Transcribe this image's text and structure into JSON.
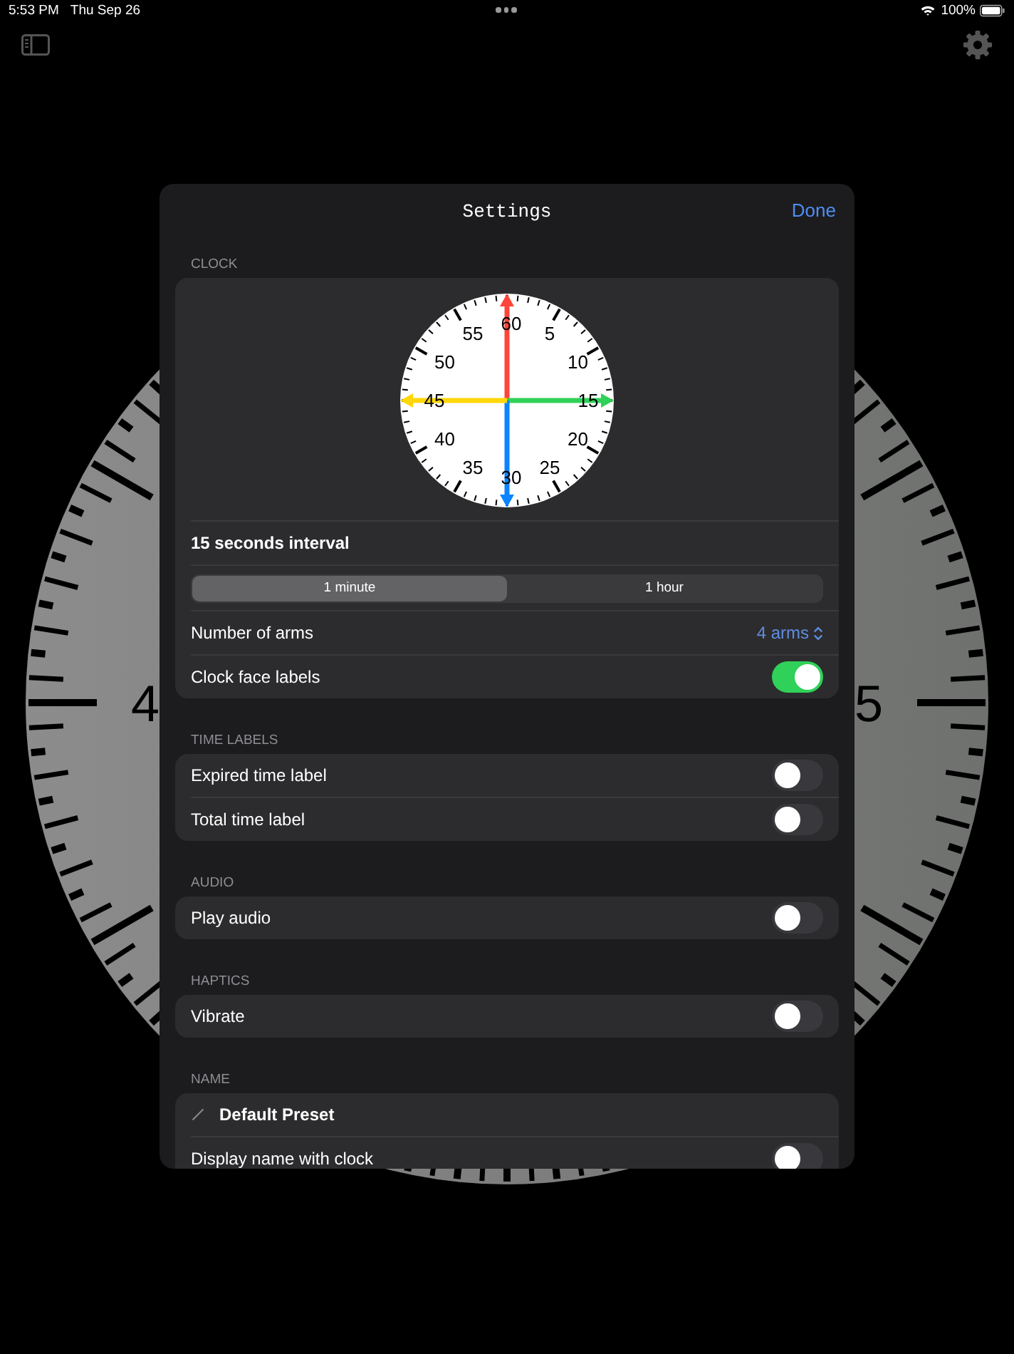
{
  "status_bar": {
    "time": "5:53 PM",
    "date": "Thu Sep 26",
    "battery": "100%"
  },
  "background_clock": {
    "labels": [
      "4",
      "5"
    ]
  },
  "settings": {
    "title": "Settings",
    "done": "Done",
    "sections": [
      {
        "header": "CLOCK",
        "rows": [
          {
            "kind": "preview",
            "labels": [
              "60",
              "5",
              "10",
              "15",
              "20",
              "25",
              "30",
              "35",
              "40",
              "45",
              "50",
              "55"
            ],
            "arms": [
              {
                "color": "#ff453a"
              },
              {
                "color": "#30d158"
              },
              {
                "color": "#0a84ff"
              },
              {
                "color": "#ffd60a"
              }
            ]
          },
          {
            "kind": "title",
            "label": "15 seconds interval"
          },
          {
            "kind": "segmented",
            "options": [
              {
                "label": "1 minute",
                "selected": true
              },
              {
                "label": "1 hour",
                "selected": false
              }
            ]
          },
          {
            "kind": "picker",
            "label": "Number of arms",
            "value": "4 arms"
          },
          {
            "kind": "toggle",
            "label": "Clock face labels",
            "on": true
          }
        ]
      },
      {
        "header": "TIME LABELS",
        "rows": [
          {
            "kind": "toggle",
            "label": "Expired time label",
            "on": false
          },
          {
            "kind": "toggle",
            "label": "Total time label",
            "on": false
          }
        ]
      },
      {
        "header": "AUDIO",
        "rows": [
          {
            "kind": "toggle",
            "label": "Play audio",
            "on": false
          }
        ]
      },
      {
        "header": "HAPTICS",
        "rows": [
          {
            "kind": "toggle",
            "label": "Vibrate",
            "on": false
          }
        ]
      },
      {
        "header": "NAME",
        "rows": [
          {
            "kind": "name",
            "value": "Default Preset"
          },
          {
            "kind": "toggle",
            "label": "Display name with clock",
            "on": false
          }
        ]
      }
    ]
  }
}
